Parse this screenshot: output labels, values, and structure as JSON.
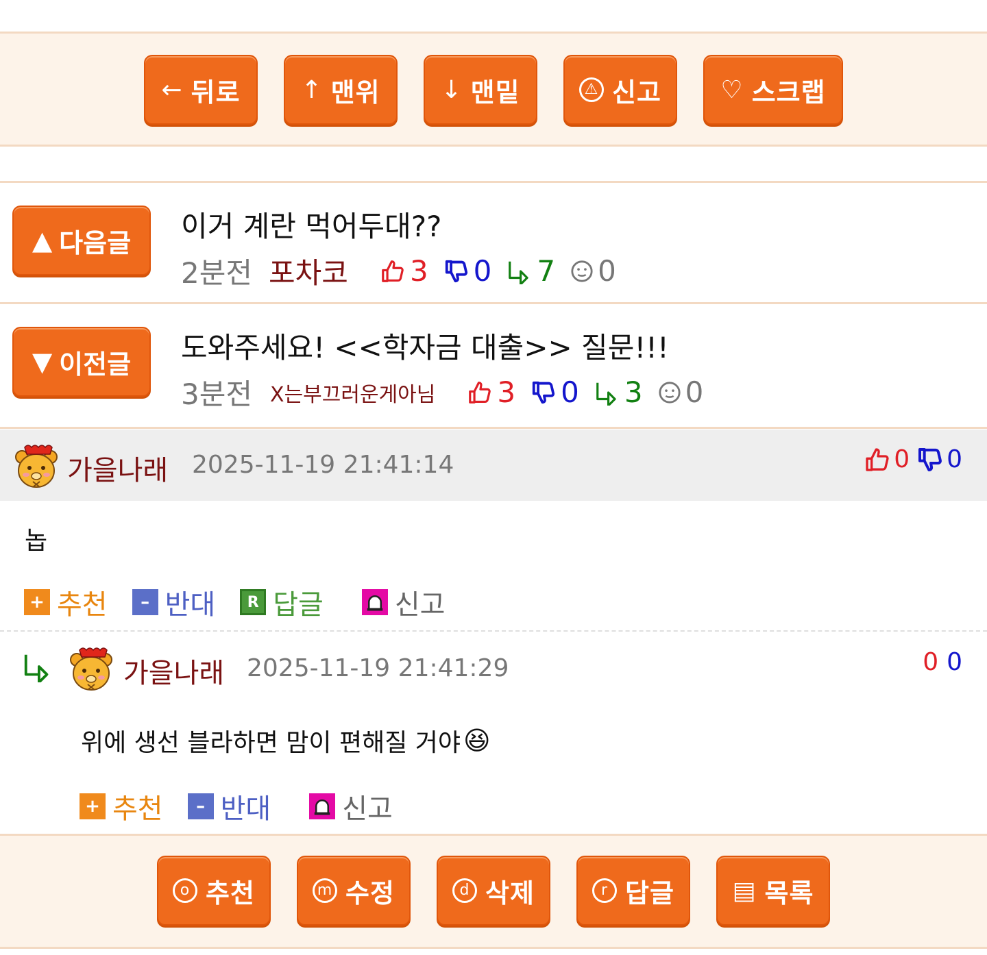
{
  "top_buttons": [
    {
      "icon": "←",
      "label": "뒤로"
    },
    {
      "icon": "↑",
      "label": "맨위"
    },
    {
      "icon": "↓",
      "label": "맨밑"
    },
    {
      "icon": "⚠",
      "label": "신고"
    },
    {
      "icon": "♡",
      "label": "스크랩"
    }
  ],
  "next_post": {
    "button_icon": "▲",
    "button_label": "다음글",
    "title": "이거 계란 먹어두대??",
    "time": "2분전",
    "author": "포차코",
    "likes": "3",
    "dislikes": "0",
    "replies": "7",
    "views": "0"
  },
  "prev_post": {
    "button_icon": "▼",
    "button_label": "이전글",
    "title": "도와주세요! <<학자금 대출>> 질문!!!",
    "time": "3분전",
    "author": "X는부끄러운게아님",
    "likes": "3",
    "dislikes": "0",
    "replies": "3",
    "views": "0"
  },
  "comments": [
    {
      "author": "가을나래",
      "date": "2025-11-19 21:41:14",
      "likes": "0",
      "dislikes": "0",
      "body": "놉",
      "actions": {
        "recommend": "추천",
        "oppose": "반대",
        "reply": "답글",
        "report": "신고"
      }
    },
    {
      "author": "가을나래",
      "date": "2025-11-19 21:41:29",
      "likes": "0",
      "dislikes": "0",
      "body": "위에 생선 블라하면 맘이 편해질 거야",
      "emoji": "😆",
      "actions": {
        "recommend": "추천",
        "oppose": "반대",
        "report": "신고"
      }
    }
  ],
  "bottom_buttons": [
    {
      "icon": "o",
      "label": "추천"
    },
    {
      "icon": "m",
      "label": "수정"
    },
    {
      "icon": "d",
      "label": "삭제"
    },
    {
      "icon": "r",
      "label": "답글"
    },
    {
      "icon": "▤",
      "label": "목록"
    }
  ],
  "colors": {
    "accent": "#ef6a1c",
    "bar_bg": "#fdf3e9",
    "like": "#e01f26",
    "dislike": "#1416cc",
    "reply": "#128012"
  }
}
